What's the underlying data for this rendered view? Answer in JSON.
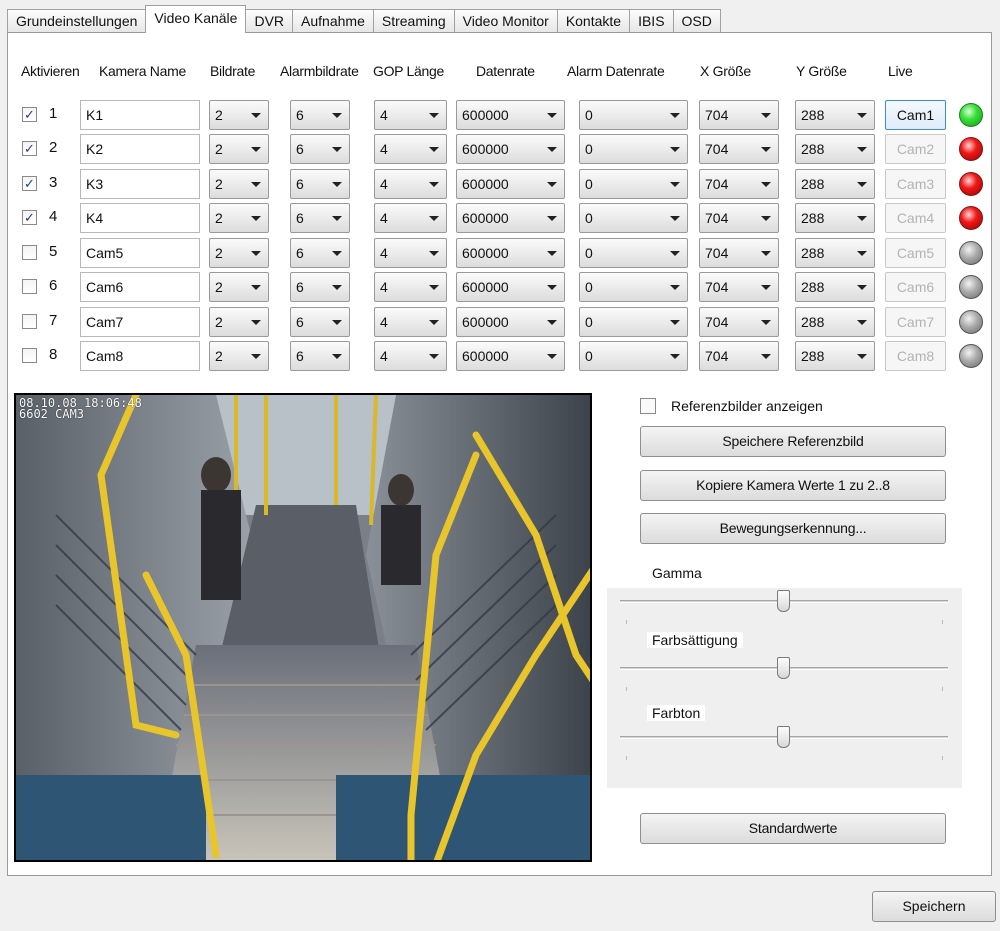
{
  "tabs": [
    "Grundeinstellungen",
    "Video Kanäle",
    "DVR",
    "Aufnahme",
    "Streaming",
    "Video Monitor",
    "Kontakte",
    "IBIS",
    "OSD"
  ],
  "active_tab": 1,
  "headers": {
    "aktivieren": "Aktivieren",
    "kamera_name": "Kamera Name",
    "bildrate": "Bildrate",
    "alarmbildrate": "Alarmbildrate",
    "gop": "GOP Länge",
    "datenrate": "Datenrate",
    "alarm_datenrate": "Alarm Datenrate",
    "x_groesse": "X Größe",
    "y_groesse": "Y Größe",
    "live": "Live"
  },
  "channels": [
    {
      "checked": true,
      "num": "1",
      "name": "K1",
      "bildrate": "2",
      "alarmbildrate": "6",
      "gop": "4",
      "datenrate": "600000",
      "alarm_datenrate": "0",
      "x": "704",
      "y": "288",
      "live": "Cam1",
      "status": "green"
    },
    {
      "checked": true,
      "num": "2",
      "name": "K2",
      "bildrate": "2",
      "alarmbildrate": "6",
      "gop": "4",
      "datenrate": "600000",
      "alarm_datenrate": "0",
      "x": "704",
      "y": "288",
      "live": "Cam2",
      "status": "red"
    },
    {
      "checked": true,
      "num": "3",
      "name": "K3",
      "bildrate": "2",
      "alarmbildrate": "6",
      "gop": "4",
      "datenrate": "600000",
      "alarm_datenrate": "0",
      "x": "704",
      "y": "288",
      "live": "Cam3",
      "status": "red"
    },
    {
      "checked": true,
      "num": "4",
      "name": "K4",
      "bildrate": "2",
      "alarmbildrate": "6",
      "gop": "4",
      "datenrate": "600000",
      "alarm_datenrate": "0",
      "x": "704",
      "y": "288",
      "live": "Cam4",
      "status": "red"
    },
    {
      "checked": false,
      "num": "5",
      "name": "Cam5",
      "bildrate": "2",
      "alarmbildrate": "6",
      "gop": "4",
      "datenrate": "600000",
      "alarm_datenrate": "0",
      "x": "704",
      "y": "288",
      "live": "Cam5",
      "status": "grey"
    },
    {
      "checked": false,
      "num": "6",
      "name": "Cam6",
      "bildrate": "2",
      "alarmbildrate": "6",
      "gop": "4",
      "datenrate": "600000",
      "alarm_datenrate": "0",
      "x": "704",
      "y": "288",
      "live": "Cam6",
      "status": "grey"
    },
    {
      "checked": false,
      "num": "7",
      "name": "Cam7",
      "bildrate": "2",
      "alarmbildrate": "6",
      "gop": "4",
      "datenrate": "600000",
      "alarm_datenrate": "0",
      "x": "704",
      "y": "288",
      "live": "Cam7",
      "status": "grey"
    },
    {
      "checked": false,
      "num": "8",
      "name": "Cam8",
      "bildrate": "2",
      "alarmbildrate": "6",
      "gop": "4",
      "datenrate": "600000",
      "alarm_datenrate": "0",
      "x": "704",
      "y": "288",
      "live": "Cam8",
      "status": "grey"
    }
  ],
  "camera_osd": {
    "line1": "08.10.08  18:06:48",
    "line2": "6602      CAM3"
  },
  "reference": {
    "checkbox_label": "Referenzbilder anzeigen",
    "checked": false
  },
  "buttons": {
    "save_reference": "Speichere Referenzbild",
    "copy_values": "Kopiere Kamera Werte 1 zu 2..8",
    "motion": "Bewegungserkennung...",
    "defaults": "Standardwerte",
    "save": "Speichern"
  },
  "sliders": [
    {
      "label": "Gamma",
      "value": 0.5
    },
    {
      "label": "Farbsättigung",
      "value": 0.5
    },
    {
      "label": "Farbton",
      "value": 0.5
    }
  ],
  "colors": {
    "green": "#39e03a",
    "red": "#f01818",
    "grey": "#a9a9a9",
    "tab_border": "#a0a0a0"
  }
}
